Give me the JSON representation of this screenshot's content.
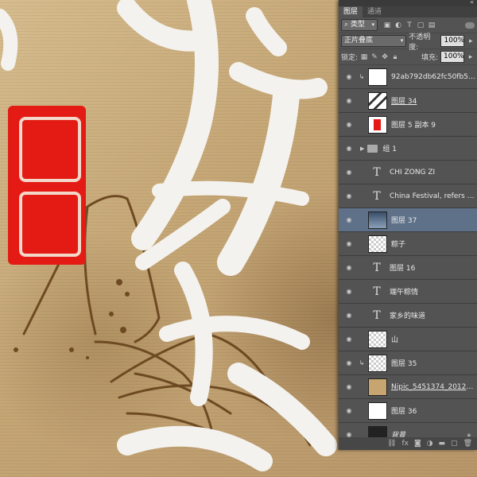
{
  "panel": {
    "tabs": [
      {
        "label": "图层"
      },
      {
        "label": "通道"
      }
    ],
    "filter": {
      "label": "类型"
    },
    "blend_mode": "正片叠底",
    "opacity_label": "不透明度:",
    "opacity_value": "100%",
    "lock_label": "锁定:",
    "fill_label": "填充:",
    "fill_value": "100%",
    "layers": [
      {
        "name": "92ab792db62fc50fb558...",
        "kind": "image",
        "thumb": "blank",
        "clipped": true
      },
      {
        "name": "图层 34",
        "kind": "image",
        "thumb": "texture"
      },
      {
        "name": "图层 5 副本 9",
        "kind": "image",
        "thumb": "seal"
      },
      {
        "name": "组 1",
        "kind": "group"
      },
      {
        "name": "CHI ZONG ZI",
        "kind": "text"
      },
      {
        "name": "China Festival, refers to t...",
        "kind": "text"
      },
      {
        "name": "图层 37",
        "kind": "image",
        "thumb": "scene",
        "selected": true
      },
      {
        "name": "粽子",
        "kind": "image",
        "thumb": "checker"
      },
      {
        "name": "图层 16",
        "kind": "text"
      },
      {
        "name": "端午粽情",
        "kind": "text"
      },
      {
        "name": "家乡的味道",
        "kind": "text"
      },
      {
        "name": "山",
        "kind": "image",
        "thumb": "checker"
      },
      {
        "name": "图层 35",
        "kind": "image",
        "thumb": "checker",
        "clipped": true
      },
      {
        "name": "Nipic_5451374_20120821...",
        "kind": "image",
        "thumb": "paper"
      },
      {
        "name": "图层 36",
        "kind": "image",
        "thumb": "blank"
      },
      {
        "name": "背景",
        "kind": "background",
        "thumb": "black",
        "locked": true
      }
    ],
    "icons": {
      "visibility": "eye-icon",
      "bottom": [
        "link-icon",
        "fx-icon",
        "mask-icon",
        "adjustment-icon",
        "new-group-icon",
        "new-layer-icon",
        "trash-icon"
      ]
    }
  }
}
